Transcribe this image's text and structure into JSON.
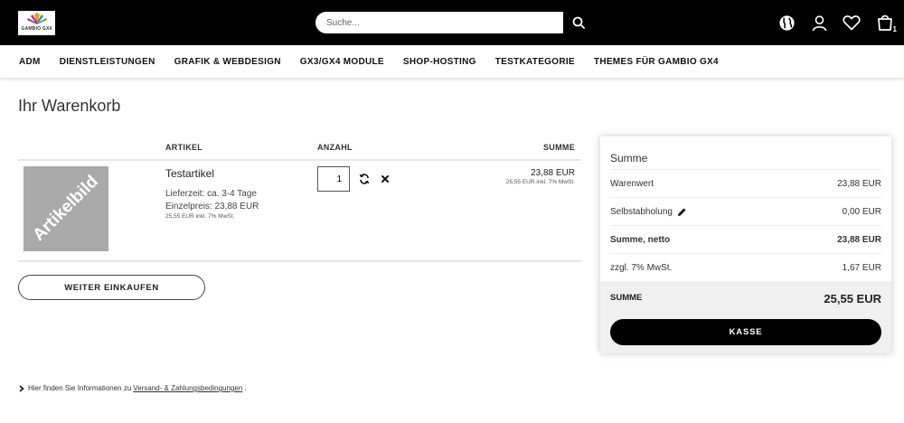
{
  "header": {
    "logo_text": "GAMBIO GX4",
    "search": {
      "placeholder": "Suche...",
      "value": ""
    },
    "icons": [
      "search-icon",
      "globe-icon",
      "user-icon",
      "heart-icon",
      "cart-icon"
    ],
    "cart_count": "1"
  },
  "nav": {
    "items": [
      "ADM",
      "DIENSTLEISTUNGEN",
      "GRAFIK & WEBDESIGN",
      "GX3/GX4 MODULE",
      "SHOP-HOSTING",
      "TESTKATEGORIE",
      "THEMES FÜR GAMBIO GX4"
    ]
  },
  "page": {
    "title": "Ihr Warenkorb"
  },
  "cart": {
    "columns": {
      "article": "ARTIKEL",
      "quantity": "ANZAHL",
      "sum": "SUMME"
    },
    "item": {
      "image_text": "Artikelbild",
      "name": "Testartikel",
      "delivery": "Lieferzeit: ca. 3-4 Tage",
      "unit_price": "Einzelpreis: 23,88 EUR",
      "unit_price_tax": "25,55 EUR inkl. 7% MwSt.",
      "quantity": "1",
      "sum": "23,88 EUR",
      "sum_tax": "25,55 EUR inkl. 7% MwSt."
    },
    "continue_label": "WEITER EINKAUFEN"
  },
  "summary": {
    "title": "Summe",
    "rows": [
      {
        "label": "Warenwert",
        "value": "23,88 EUR"
      },
      {
        "label": "Selbstabholung",
        "value": "0,00 EUR"
      },
      {
        "label": "Summe, netto",
        "value": "23,88 EUR"
      },
      {
        "label": "zzgl. 7% MwSt.",
        "value": "1,67 EUR"
      }
    ],
    "total_label": "SUMME",
    "total_value": "25,55 EUR",
    "checkout_label": "KASSE"
  },
  "footer": {
    "prefix": "Hier finden Sie Informationen zu",
    "link": "Versand- & Zahlungsbedingungen",
    "suffix": "."
  },
  "colors": {
    "header_bg": "#000000",
    "button_bg": "#000000",
    "total_bg": "#f0f0f0",
    "placeholder_image": "#aaaaaa"
  }
}
